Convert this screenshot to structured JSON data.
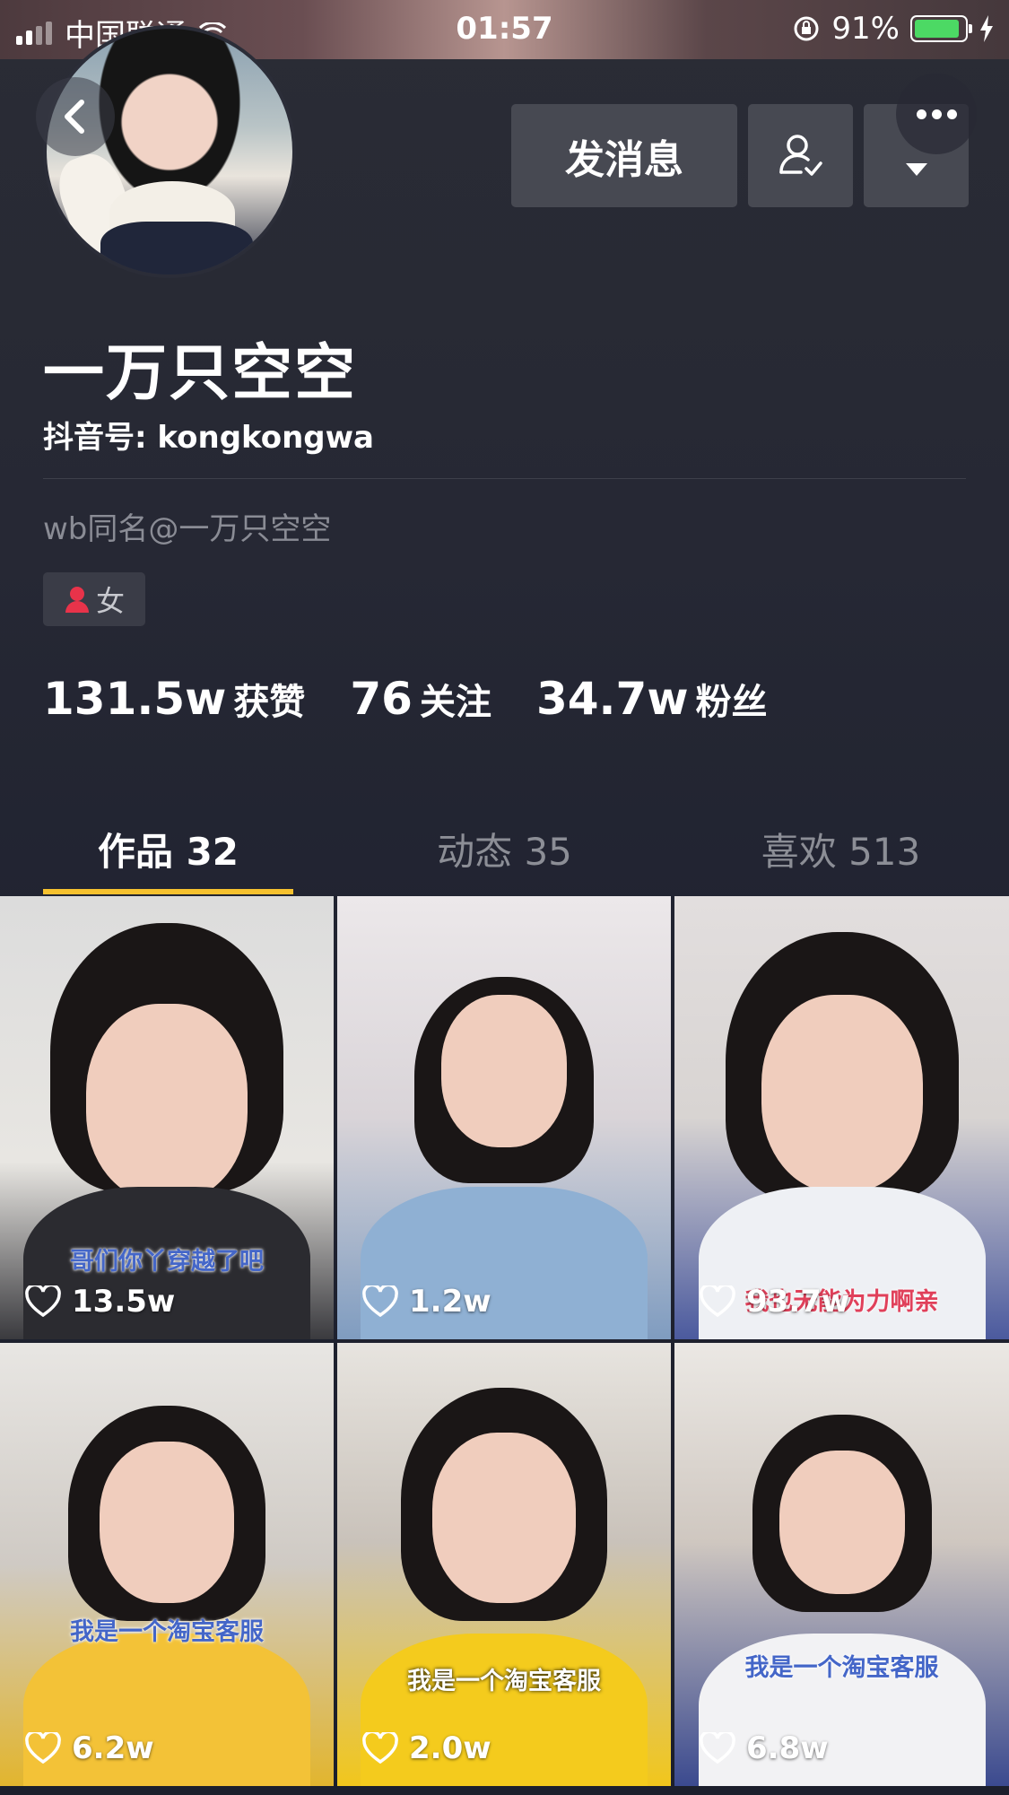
{
  "status_bar": {
    "carrier": "中国联通",
    "time": "01:57",
    "battery": "91%",
    "battery_level": 0.91
  },
  "header": {
    "message_button": "发消息",
    "follow_icon": "user-check-icon",
    "dropdown_icon": "triangle-down-icon",
    "back_icon": "chevron-left-icon",
    "more_icon": "ellipsis-icon"
  },
  "profile": {
    "name": "一万只空空",
    "douyin_id": "抖音号: kongkongwa",
    "bio": "wb同名@一万只空空",
    "gender": "女",
    "gender_color": "#e8334a"
  },
  "stats": [
    {
      "value": "131.5w",
      "label": "获赞"
    },
    {
      "value": "76",
      "label": "关注"
    },
    {
      "value": "34.7w",
      "label": "粉丝"
    }
  ],
  "tabs": [
    {
      "label": "作品 32",
      "active": true
    },
    {
      "label": "动态 35",
      "active": false
    },
    {
      "label": "喜欢 513",
      "active": false
    }
  ],
  "accent_color": "#f6c12f",
  "videos": [
    {
      "likes": "13.5w",
      "caption": "哥们你丫穿越了吧"
    },
    {
      "likes": "1.2w",
      "caption": ""
    },
    {
      "likes": "93.7w",
      "caption": "我也无能为力啊亲"
    },
    {
      "likes": "6.2w",
      "caption": "我是一个淘宝客服"
    },
    {
      "likes": "2.0w",
      "caption": "我是一个淘宝客服"
    },
    {
      "likes": "6.8w",
      "caption": "我是一个淘宝客服"
    }
  ]
}
